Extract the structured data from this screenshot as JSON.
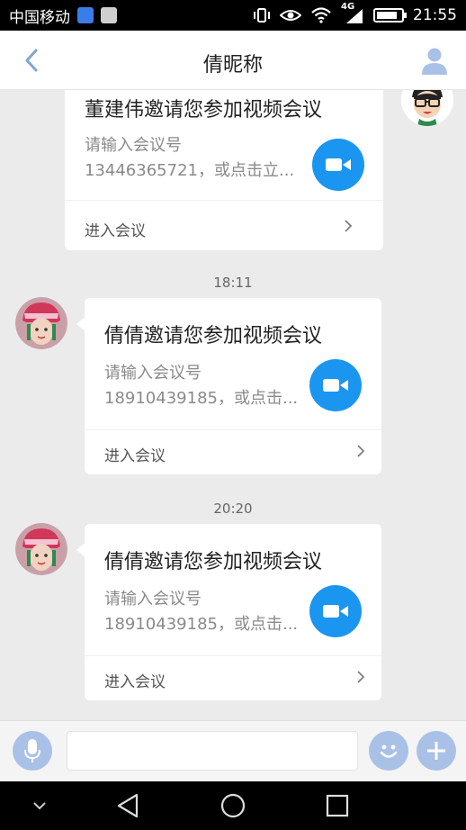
{
  "status_bar": {
    "carrier": "中国移动",
    "network": "4G",
    "time": "21:55",
    "battery_level": 0.85
  },
  "header": {
    "title": "倩昵称"
  },
  "messages": [
    {
      "sender": "self",
      "title": "董建伟邀请您参加视频会议",
      "line1": "请输入会议号",
      "line2": "13446365721，或点击立...",
      "action": "进入会议"
    },
    {
      "timestamp": "18:11",
      "sender": "other",
      "title": "倩倩邀请您参加视频会议",
      "line1": "请输入会议号",
      "line2": "18910439185，或点击...",
      "action": "进入会议"
    },
    {
      "timestamp": "20:20",
      "sender": "other",
      "title": "倩倩邀请您参加视频会议",
      "line1": "请输入会议号",
      "line2": "18910439185，或点击...",
      "action": "进入会议"
    }
  ],
  "colors": {
    "accent": "#1a96f0",
    "icon_soft": "#a9c1e6",
    "background": "#ebebeb"
  },
  "icons": {
    "back": "chevron-left-icon",
    "profile": "user-icon",
    "video": "video-camera-icon",
    "mic": "microphone-icon",
    "emoji": "smiley-icon",
    "plus": "plus-icon"
  }
}
